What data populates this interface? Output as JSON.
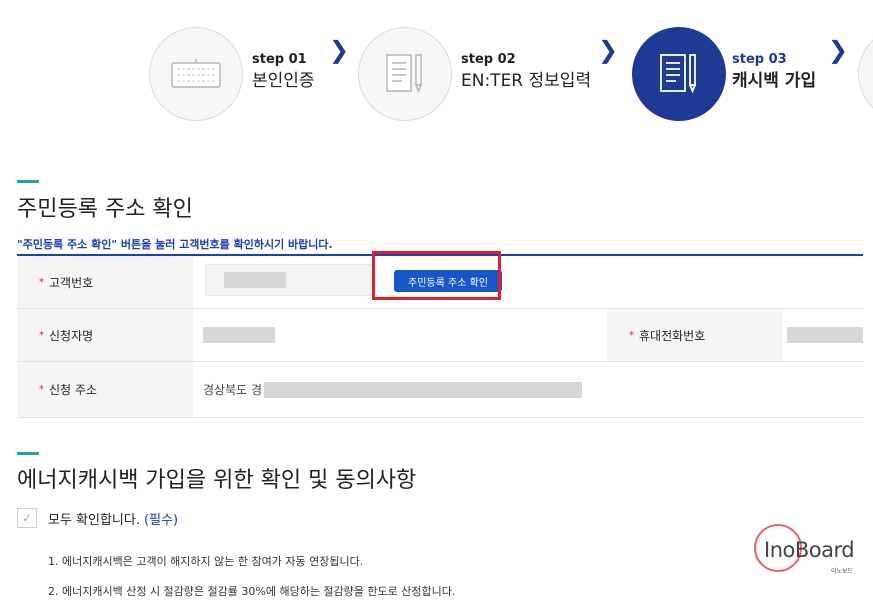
{
  "steps": [
    {
      "num": "step 01",
      "title": "본인인증",
      "icon": "keyboard-icon",
      "active": false
    },
    {
      "num": "step 02",
      "title": "EN:TER 정보입력",
      "icon": "form-pencil-icon",
      "active": false
    },
    {
      "num": "step 03",
      "title": "캐시백 가입",
      "icon": "form-pencil-icon",
      "active": true
    }
  ],
  "section1": {
    "title": "주민등록 주소 확인",
    "notice": "\"주민등록 주소 확인\" 버튼을 눌러 고객번호를 확인하시기 바랍니다.",
    "req_mark": "*",
    "fields": {
      "customer_no_label": "고객번호",
      "confirm_button": "주민등록 주소 확인",
      "applicant_name_label": "신청자명",
      "mobile_label": "휴대전화번호",
      "address_label": "신청 주소",
      "address_prefix": "경상북도 경"
    }
  },
  "section2": {
    "title": "에너지캐시백 가입을 위한 확인 및 동의사항",
    "agree_all_label": "모두 확인합니다.",
    "agree_all_required": "(필수)",
    "check_mark": "✓",
    "terms": [
      "1. 에너지캐시백은 고객이 해지하지 않는 한 참여가 자동 연장됩니다.",
      "2. 에너지캐시백 산정 시 절감량은 절감률 30%에 해당하는 절감량을 한도로 산정합니다."
    ]
  },
  "watermark": {
    "text": "InoBoard",
    "sub": "이노보드"
  },
  "colors": {
    "primary": "#1f3a93",
    "accent_green": "#1aa89a",
    "button_blue": "#1857c9",
    "highlight_red": "#e0202a"
  }
}
